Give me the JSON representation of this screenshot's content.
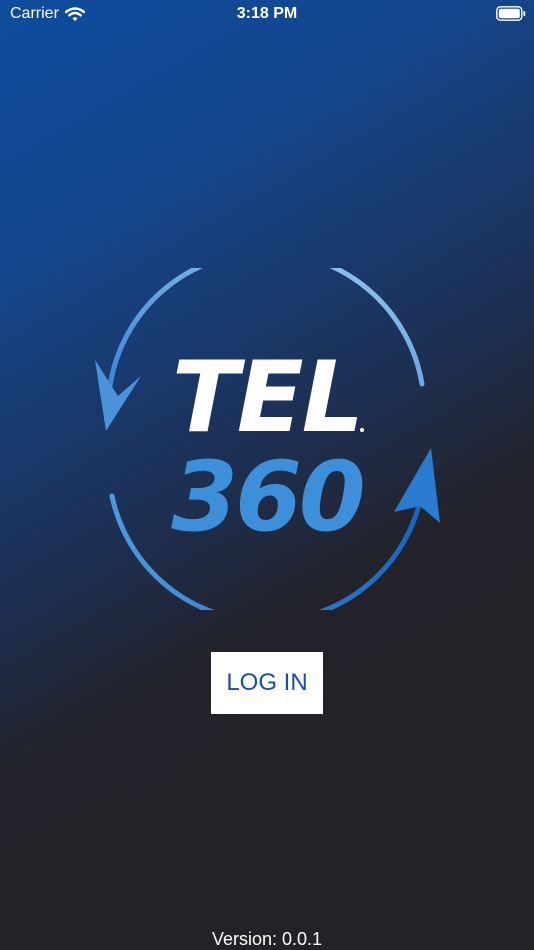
{
  "status_bar": {
    "carrier": "Carrier",
    "time": "3:18 PM",
    "wifi_icon": "wifi-icon",
    "battery_icon": "battery-icon"
  },
  "logo": {
    "line1": "TEL",
    "line2": "360",
    "colors": {
      "arrow_light": "#7fb6e6",
      "arrow_dark": "#1c6fc6",
      "digits": "#3d8fda",
      "letters": "#ffffff"
    }
  },
  "login": {
    "label": "LOG IN",
    "text_color": "#1b4fa0"
  },
  "footer": {
    "version": "Version: 0.0.1"
  }
}
